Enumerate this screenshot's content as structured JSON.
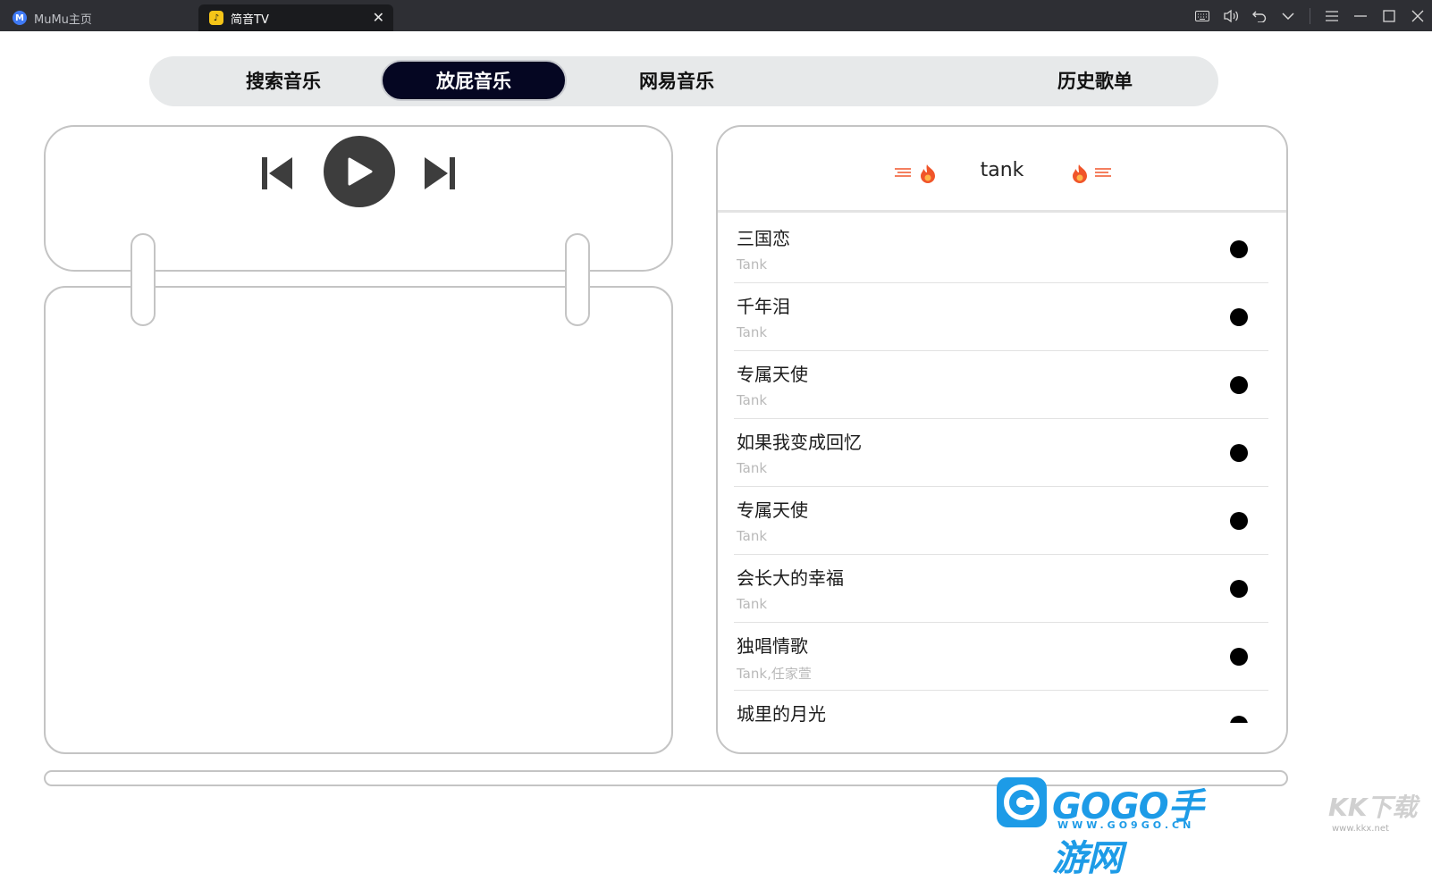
{
  "titlebar": {
    "home_tab": "MuMu主页",
    "active_tab": "简音TV"
  },
  "nav": {
    "tabs": [
      "搜索音乐",
      "放屁音乐",
      "网易音乐",
      "历史歌单"
    ],
    "active_index": 1
  },
  "playlist": {
    "title": "tank",
    "songs": [
      {
        "title": "三国恋",
        "artist": "Tank"
      },
      {
        "title": "千年泪",
        "artist": "Tank"
      },
      {
        "title": "专属天使",
        "artist": "Tank"
      },
      {
        "title": "如果我变成回忆",
        "artist": "Tank"
      },
      {
        "title": "专属天使",
        "artist": "Tank"
      },
      {
        "title": "会长大的幸福",
        "artist": "Tank"
      },
      {
        "title": "独唱情歌",
        "artist": "Tank,任家萱"
      },
      {
        "title": "城里的月光",
        "artist": ""
      }
    ]
  },
  "watermarks": {
    "gogo": "GOGO手游网",
    "gogo_url": "WWW.GO9GO.CN",
    "kk": "KK下载",
    "kk_url": "www.kkx.net"
  },
  "colors": {
    "titlebar_bg": "#2e2f34",
    "nav_bg": "#e7e9ea",
    "nav_active_bg": "#050622",
    "play_button": "#3d3d3d",
    "flame": "#f0552a"
  },
  "icons": {
    "player": [
      "skip-previous-icon",
      "play-icon",
      "skip-next-icon"
    ],
    "window": [
      "keyboard-icon",
      "volume-icon",
      "undo-icon",
      "chevron-down-icon",
      "menu-icon",
      "minimize-icon",
      "maximize-icon",
      "close-icon"
    ]
  }
}
